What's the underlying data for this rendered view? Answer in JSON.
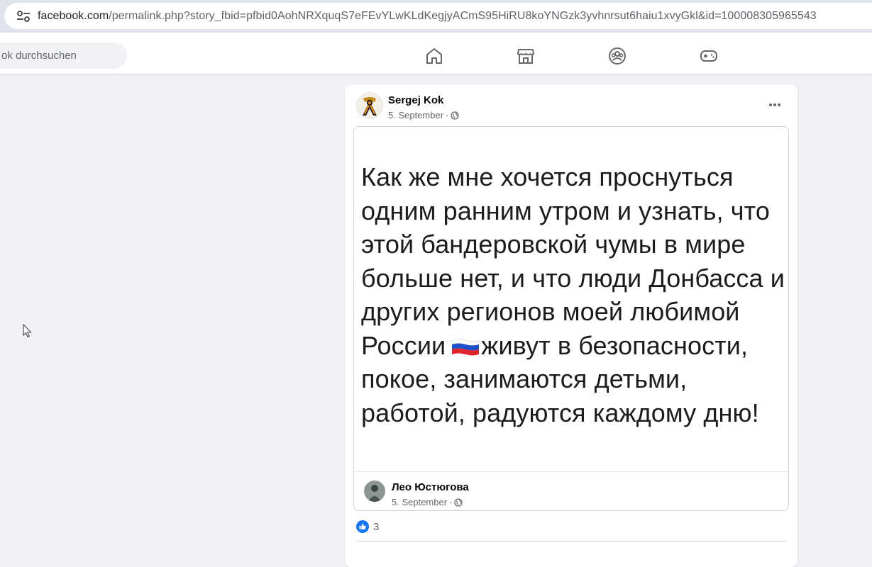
{
  "browser": {
    "url_domain": "facebook.com",
    "url_rest": "/permalink.php?story_fbid=pfbid0AohNRXquqS7eFEvYLwKLdKegjyACmS95HiRU8koYNGzk3yvhnrsut6haiu1xvyGkl&id=100008305965543"
  },
  "nav": {
    "search_placeholder": "ok durchsuchen",
    "icons": [
      "home-icon",
      "marketplace-icon",
      "groups-icon",
      "gaming-icon"
    ]
  },
  "post": {
    "author": "Sergej Kok",
    "date": "5. September",
    "separator": "·",
    "image_text_before_flag": "Как же мне хочется проснуться одним ранним утром и узнать, что этой бандеровской чумы в мире больше нет, и что люди Донбасса и других регионов моей любимой России",
    "image_text_after_flag": "живут в безопасности, покое, занимаются детьми, работой, радуются каждому дню!",
    "shared_author": "Лео Юстюгова",
    "shared_date": "5. September",
    "reaction_count": "3"
  },
  "colors": {
    "fb_blue": "#1877f2",
    "background": "#f0f2f5",
    "secondary_text": "#65676b"
  }
}
